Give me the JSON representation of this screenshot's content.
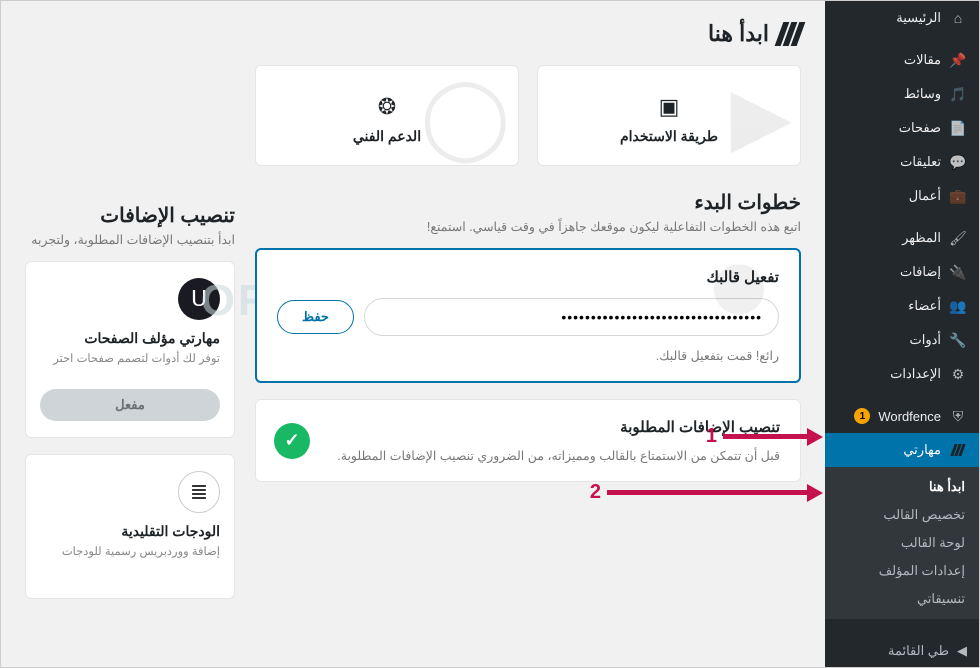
{
  "sidebar": {
    "items": [
      {
        "icon": "dashboard",
        "label": "الرئيسية"
      },
      {
        "icon": "pin",
        "label": "مقالات"
      },
      {
        "icon": "media",
        "label": "وسائط"
      },
      {
        "icon": "page",
        "label": "صفحات"
      },
      {
        "icon": "comment",
        "label": "تعليقات"
      },
      {
        "icon": "portfolio",
        "label": "أعمال"
      },
      {
        "icon": "appearance",
        "label": "المظهر"
      },
      {
        "icon": "plugin",
        "label": "إضافات"
      },
      {
        "icon": "users",
        "label": "أعضاء"
      },
      {
        "icon": "tools",
        "label": "أدوات"
      },
      {
        "icon": "settings",
        "label": "الإعدادات"
      },
      {
        "icon": "shield",
        "label": "Wordfence",
        "badge": "1"
      },
      {
        "icon": "stripes",
        "label": "مهارتي",
        "active": true
      }
    ],
    "submenu": [
      {
        "label": "ابدأ هنا",
        "current": true
      },
      {
        "label": "تخصيص القالب"
      },
      {
        "label": "لوحة القالب"
      },
      {
        "label": "إعدادات المؤلف"
      },
      {
        "label": "تنسيقاتي"
      }
    ],
    "collapse": "طي القائمة"
  },
  "page": {
    "title": "ابدأ هنا",
    "cards": [
      {
        "label": "طريقة الاستخدام",
        "icon": "▶"
      },
      {
        "label": "الدعم الفني",
        "icon": "✿"
      }
    ],
    "start": {
      "title": "خطوات البدء",
      "sub": "اتبع هذه الخطوات التفاعلية ليكون موقعك جاهزاً في وقت قياسي. استمتع!"
    },
    "activate": {
      "title": "تفعيل قالبك",
      "value": "••••••••••••••••••••••••••••••••••",
      "save": "حفظ",
      "success": "رائع! قمت بتفعيل قالبك."
    },
    "step2": {
      "title": "تنصيب الإضافات المطلوبة",
      "desc": "قبل أن تتمكن من الاستمتاع بالقالب ومميزاته، من الضروري تنصيب الإضافات المطلوبة."
    },
    "plugins_panel": {
      "title": "تنصيب الإضافات",
      "sub": "ابدأ بتنصيب الإضافات المطلوبة، ولتجربه",
      "items": [
        {
          "name": "مهارتي مؤلف الصفحات",
          "desc": "توفر لك أدوات لتصمم صفحات احتر",
          "status": "مفعل",
          "ico": "u",
          "sym": "ᑌ"
        },
        {
          "name": "الودجات التقليدية",
          "desc": "إضافة ووردبريس رسمية للودجات",
          "status": "",
          "ico": "e",
          "sym": "≣"
        }
      ]
    }
  },
  "watermark": "ORIDSITE.COM",
  "annotations": [
    {
      "num": "1"
    },
    {
      "num": "2"
    }
  ]
}
